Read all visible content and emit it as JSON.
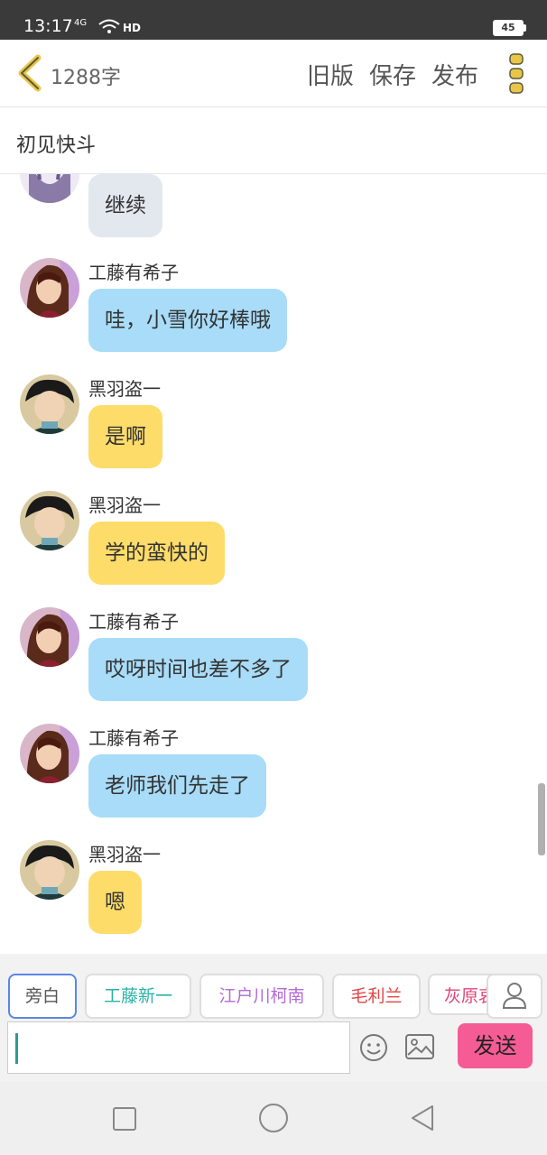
{
  "status_bar": {
    "time": "13:17",
    "signal": "4G",
    "wifi": "HD",
    "battery": "45"
  },
  "topbar": {
    "word_count": "1288字",
    "old_version": "旧版",
    "save": "保存",
    "publish": "发布"
  },
  "title": "初见快斗",
  "colors": {
    "blue_bubble": "#a8dcf8",
    "yellow_bubble": "#fddc6a",
    "gray_bubble": "#e3e8ef",
    "send_button": "#f55c95",
    "accent_icon": "#e9c64a"
  },
  "messages": [
    {
      "speaker": "",
      "text": "继续",
      "style": "gray",
      "avatar": "girl-avatar"
    },
    {
      "speaker": "工藤有希子",
      "text": "哇，小雪你好棒哦",
      "style": "blue",
      "avatar": "yukiko-avatar"
    },
    {
      "speaker": "黑羽盗一",
      "text": "是啊",
      "style": "yellow",
      "avatar": "toichi-avatar"
    },
    {
      "speaker": "黑羽盗一",
      "text": "学的蛮快的",
      "style": "yellow",
      "avatar": "toichi-avatar"
    },
    {
      "speaker": "工藤有希子",
      "text": "哎呀时间也差不多了",
      "style": "blue",
      "avatar": "yukiko-avatar"
    },
    {
      "speaker": "工藤有希子",
      "text": "老师我们先走了",
      "style": "blue",
      "avatar": "yukiko-avatar"
    },
    {
      "speaker": "黑羽盗一",
      "text": "嗯",
      "style": "yellow",
      "avatar": "toichi-avatar"
    }
  ],
  "characters": [
    {
      "label": "旁白",
      "color": "#555555"
    },
    {
      "label": "工藤新一",
      "color": "#2ab3a6"
    },
    {
      "label": "江户川柯南",
      "color": "#b36ad6"
    },
    {
      "label": "毛利兰",
      "color": "#e04545"
    },
    {
      "label": "灰原哀",
      "color": "#e0457a"
    }
  ],
  "composer": {
    "send": "发送"
  }
}
